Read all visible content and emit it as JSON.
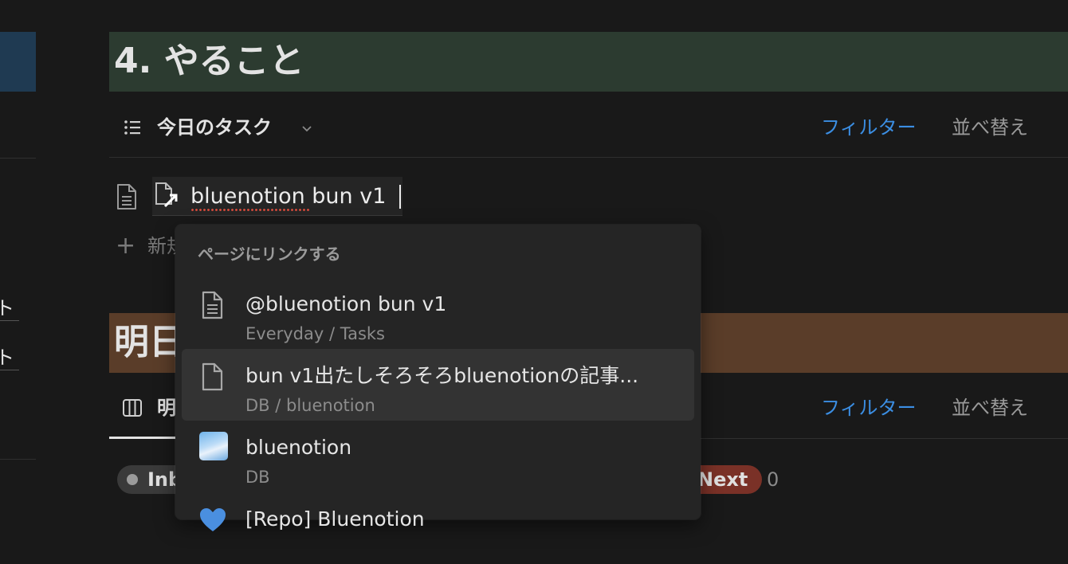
{
  "left_edge": {
    "fragment_1": "ト",
    "fragment_2": "ト"
  },
  "section_today": {
    "heading": "4. やること",
    "view_name": "今日のタスク",
    "filter_label": "フィルター",
    "sort_label": "並べ替え",
    "editing_value": "bluenotion bun v1",
    "new_row_label": "新規"
  },
  "section_tomorrow": {
    "heading": "明日",
    "view_name": "明",
    "filter_label": "フィルター",
    "sort_label": "並べ替え",
    "groups": [
      {
        "label": "Inb",
        "dot_color": "#9b9b9b",
        "bg": "#3a3a3a"
      },
      {
        "label": "Next",
        "count": "0",
        "bg": "#7a3127",
        "dot_color": "#e06b5b"
      }
    ]
  },
  "dropdown": {
    "header": "ページにリンクする",
    "items": [
      {
        "title": "@bluenotion bun v1",
        "subtitle": "Everyday / Tasks",
        "icon": "page-icon"
      },
      {
        "title": "bun v1出たしそろそろbluenotionの記事...",
        "subtitle": "DB / bluenotion",
        "icon": "page-icon"
      },
      {
        "title": "bluenotion",
        "subtitle": "DB",
        "icon": "sky-thumbnail"
      },
      {
        "title": "[Repo] Bluenotion",
        "subtitle": "",
        "icon": "blue-heart-icon"
      }
    ]
  },
  "colors": {
    "accent": "#3b8ee3",
    "heading1_bg": "#2c3b30",
    "heading2_bg": "#5a3d29",
    "background": "#191919"
  }
}
